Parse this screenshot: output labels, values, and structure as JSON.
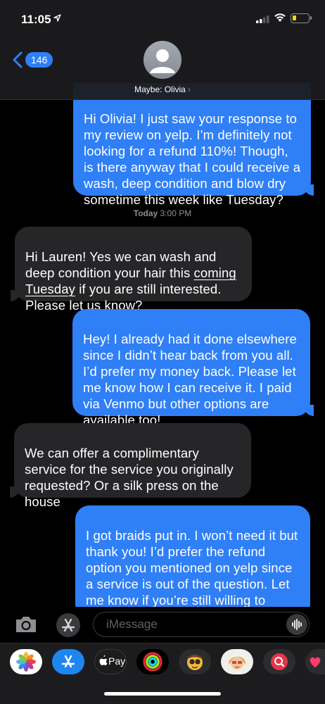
{
  "status_bar": {
    "time": "11:05"
  },
  "header": {
    "back_count": "146",
    "contact_name": "Maybe: Olivia",
    "chevron": "›"
  },
  "conversation": {
    "timestamp_day": "Today",
    "timestamp_time": "3:00 PM",
    "messages": [
      {
        "direction": "outgoing",
        "text": "Hi Olivia! I just saw your response to my review on yelp. I’m definitely not looking for a refund 110%! Though, is there anyway that I could receive a wash, deep condition and blow dry sometime this week like Tuesday?"
      },
      {
        "direction": "incoming",
        "text_pre": "Hi Lauren! Yes we can wash and deep condition your hair this ",
        "text_link": "coming Tuesday",
        "text_post": " if you are still interested. Please let us know?"
      },
      {
        "direction": "outgoing",
        "text": "Hey! I already had it done elsewhere since I didn’t hear back from you all. I’d prefer my money back. Please let me know how I can receive it. I paid via Venmo but other options are available too!"
      },
      {
        "direction": "incoming",
        "text": "We can offer a complimentary service for the service you originally requested? Or a silk press on the house"
      },
      {
        "direction": "outgoing",
        "text": "I got braids put in. I won’t need it but thank you! I’d prefer the refund option you mentioned on yelp since a service is out of the question. Let me know if you’re still willing to honor your word!"
      }
    ]
  },
  "input_bar": {
    "placeholder": "iMessage"
  },
  "app_drawer": {
    "apps": [
      {
        "icon": "photos-icon"
      },
      {
        "icon": "app-store-icon"
      },
      {
        "icon": "apple-pay-icon",
        "label": "Pay"
      },
      {
        "icon": "activity-icon"
      },
      {
        "icon": "animoji-icon"
      },
      {
        "icon": "memoji-icon"
      },
      {
        "icon": "search-images-icon"
      },
      {
        "icon": "heart-icon"
      }
    ]
  },
  "colors": {
    "outgoing_bubble": "#2f7ff6",
    "incoming_bubble": "#262629",
    "background": "#000000",
    "accent": "#2f7ff6"
  }
}
